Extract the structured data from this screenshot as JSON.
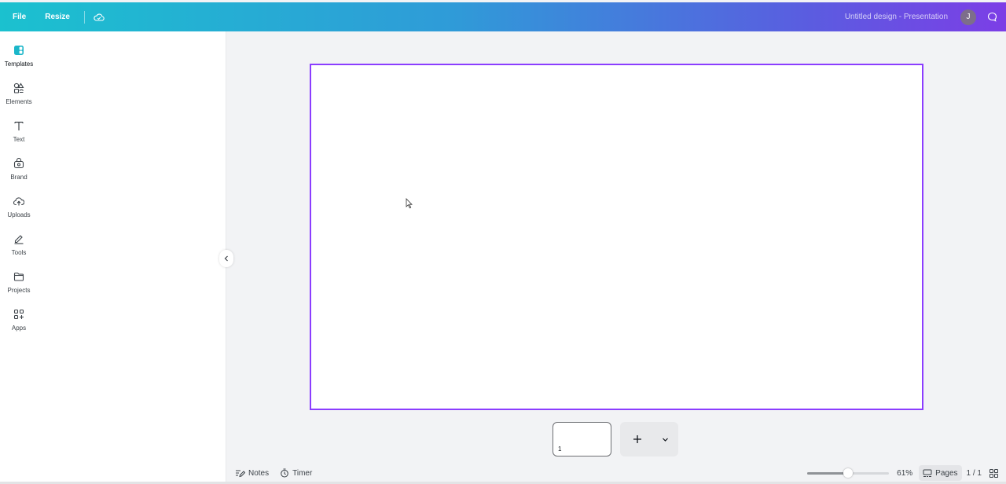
{
  "topbar": {
    "file_label": "File",
    "resize_label": "Resize",
    "cloud_icon": "cloud-icon",
    "doc_title": "Untitled design - Presentation",
    "avatar_initial": "J",
    "comment_icon": "comment-icon"
  },
  "sidebar": {
    "items": [
      {
        "label": "Templates",
        "icon": "templates-icon"
      },
      {
        "label": "Elements",
        "icon": "elements-icon"
      },
      {
        "label": "Text",
        "icon": "text-icon"
      },
      {
        "label": "Brand",
        "icon": "brand-icon"
      },
      {
        "label": "Uploads",
        "icon": "uploads-icon"
      },
      {
        "label": "Tools",
        "icon": "tools-icon"
      },
      {
        "label": "Projects",
        "icon": "folder-icon"
      },
      {
        "label": "Apps",
        "icon": "apps-icon"
      }
    ],
    "active_index": 0
  },
  "pages": {
    "thumbnails": [
      {
        "number": "1"
      }
    ]
  },
  "bottombar": {
    "notes_label": "Notes",
    "timer_label": "Timer",
    "zoom_level": 0.5,
    "zoom_percent": "61%",
    "pages_label": "Pages",
    "page_count": "1 / 1"
  },
  "colors": {
    "accent": "#8b3dff",
    "teal": "#1bc1cf",
    "purple": "#7c3ee6"
  }
}
